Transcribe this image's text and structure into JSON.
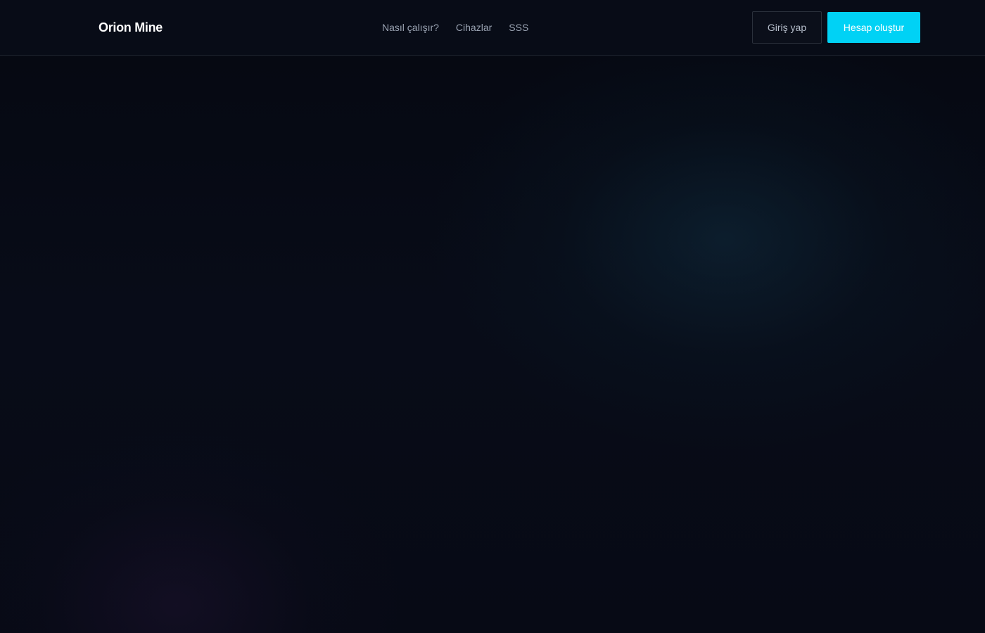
{
  "header": {
    "logo": "Orion Mine",
    "nav": [
      {
        "label": "Nasıl çalışır?"
      },
      {
        "label": "Cihazlar"
      },
      {
        "label": "SSS"
      }
    ],
    "login_label": "Giriş yap",
    "signup_label": "Hesap oluştur"
  },
  "colors": {
    "background": "#070a14",
    "accent": "#00d2f5",
    "nav_text": "#9aa3b2",
    "border": "#1f2530"
  }
}
